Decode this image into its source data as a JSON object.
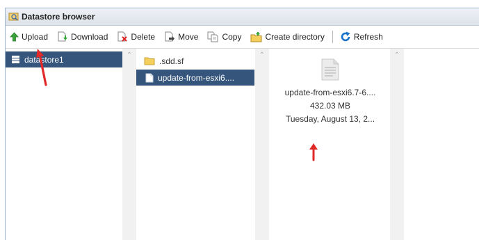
{
  "window": {
    "title": "Datastore browser"
  },
  "toolbar": {
    "upload": "Upload",
    "download": "Download",
    "delete": "Delete",
    "move": "Move",
    "copy": "Copy",
    "create_directory": "Create directory",
    "refresh": "Refresh"
  },
  "datastores": [
    {
      "label": "datastore1",
      "selected": true
    }
  ],
  "folder_items": [
    {
      "label": ".sdd.sf",
      "icon": "folder-icon",
      "selected": false
    },
    {
      "label": "update-from-esxi6....",
      "icon": "file-icon",
      "selected": true
    }
  ],
  "preview": {
    "name": "update-from-esxi6.7-6....",
    "size": "432.03 MB",
    "date": "Tuesday, August 13, 2..."
  },
  "colors": {
    "selection": "#35557d",
    "annotation_arrow": "#e02a2a",
    "accent": "#1a73c8"
  }
}
